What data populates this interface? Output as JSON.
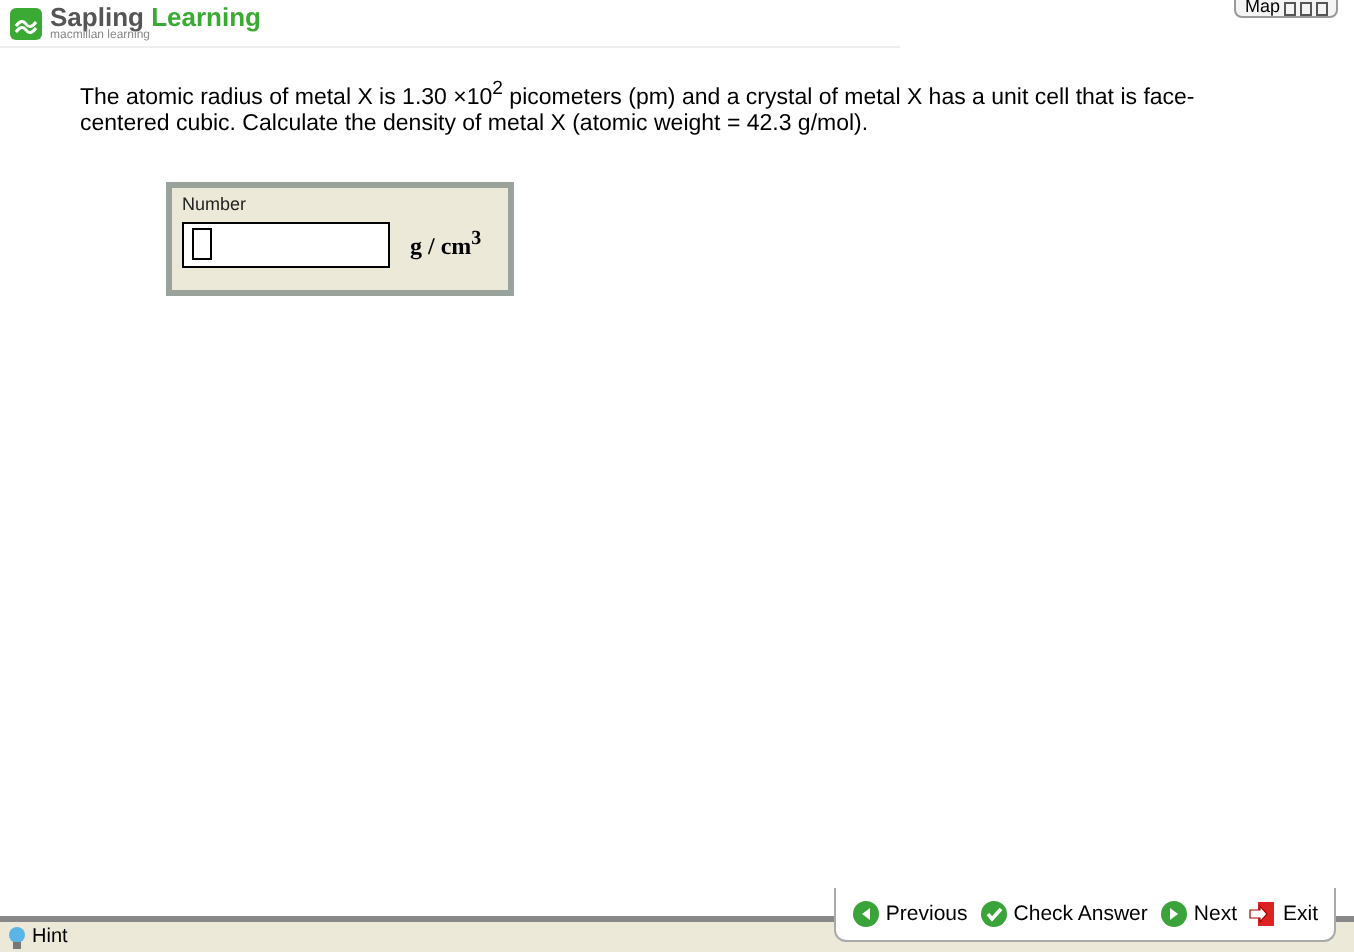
{
  "header": {
    "brand_first": "Sapling",
    "brand_second": "Learning",
    "tagline": "macmillan learning",
    "map_button": "Map"
  },
  "question": {
    "text": "The atomic radius of metal X is 1.30 ×10$^{2}$ picometers (pm) and a crystal of metal X has a unit cell that is face-centered cubic.  Calculate the density of metal X (atomic weight = 42.3 g/mol)."
  },
  "answer": {
    "label": "Number",
    "unit": "g / cm$^{3}$"
  },
  "nav": [
    {
      "kind": "previous",
      "label": "Previous"
    },
    {
      "kind": "check",
      "label": "Check Answer"
    },
    {
      "kind": "next",
      "label": "Next"
    },
    {
      "kind": "exit",
      "label": "Exit"
    }
  ],
  "hint": {
    "label": "Hint"
  }
}
